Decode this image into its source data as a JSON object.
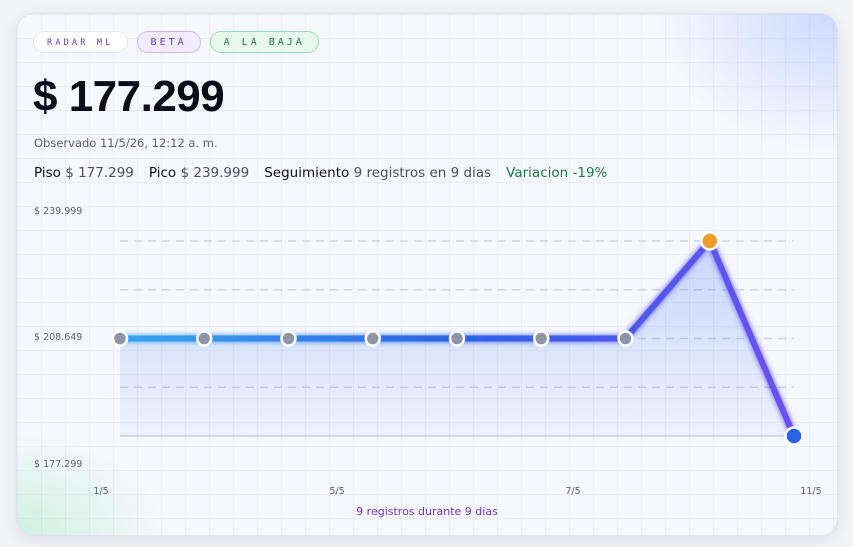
{
  "badges": {
    "radar": "RADAR ML",
    "beta": "BETA",
    "trend": "A LA BAJA"
  },
  "price": "$ 177.299",
  "observed": "Observado 11/5/26, 12:12 a. m.",
  "stats": {
    "floor_label": "Piso",
    "floor_value": "$ 177.299",
    "peak_label": "Pico",
    "peak_value": "$ 239.999",
    "tracking_label": "Seguimiento",
    "tracking_value": "9 registros en 9 dias",
    "variation": "Variacion -19%"
  },
  "colors": {
    "line_start": "#3aa5ef",
    "line_mid": "#2c63e4",
    "line_end": "#6d4ff0",
    "peak_marker": "#f29a2a",
    "last_marker": "#2c63e4",
    "point_marker": "#8d95a6"
  },
  "chart_data": {
    "type": "line",
    "x": [
      "1/5",
      "",
      "",
      "",
      "5/5",
      "",
      "7/5",
      "",
      "11/5"
    ],
    "values": [
      208649,
      208649,
      208649,
      208649,
      208649,
      208649,
      208649,
      239999,
      177299
    ],
    "ylim": [
      177299,
      239999
    ],
    "ytick_labels": [
      "$ 239.999",
      "$ 208.649",
      "$ 177.299"
    ],
    "xtick_labels": [
      "1/5",
      "5/5",
      "7/5",
      "11/5"
    ],
    "peak_index": 7,
    "footer": "9 registros durante 9 dias"
  }
}
